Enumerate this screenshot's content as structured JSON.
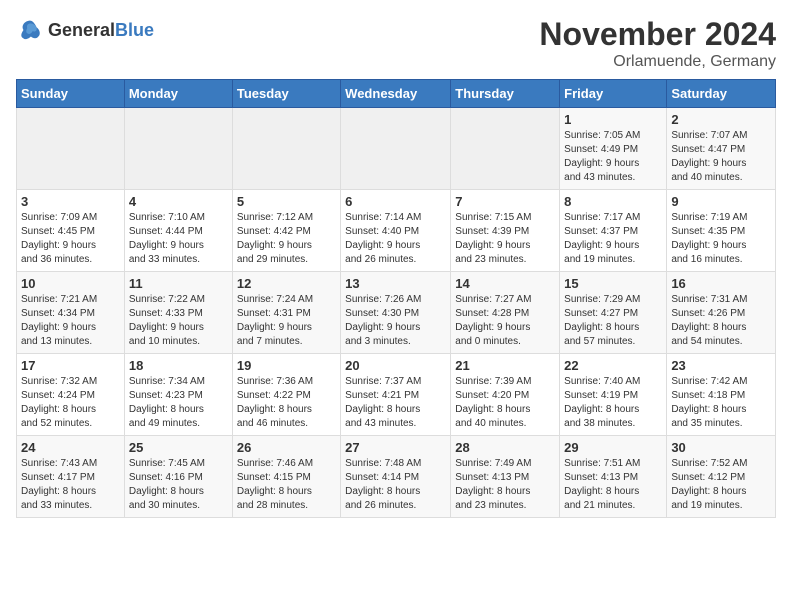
{
  "header": {
    "logo_general": "General",
    "logo_blue": "Blue",
    "month": "November 2024",
    "location": "Orlamuende, Germany"
  },
  "weekdays": [
    "Sunday",
    "Monday",
    "Tuesday",
    "Wednesday",
    "Thursday",
    "Friday",
    "Saturday"
  ],
  "weeks": [
    [
      {
        "day": "",
        "info": ""
      },
      {
        "day": "",
        "info": ""
      },
      {
        "day": "",
        "info": ""
      },
      {
        "day": "",
        "info": ""
      },
      {
        "day": "",
        "info": ""
      },
      {
        "day": "1",
        "info": "Sunrise: 7:05 AM\nSunset: 4:49 PM\nDaylight: 9 hours\nand 43 minutes."
      },
      {
        "day": "2",
        "info": "Sunrise: 7:07 AM\nSunset: 4:47 PM\nDaylight: 9 hours\nand 40 minutes."
      }
    ],
    [
      {
        "day": "3",
        "info": "Sunrise: 7:09 AM\nSunset: 4:45 PM\nDaylight: 9 hours\nand 36 minutes."
      },
      {
        "day": "4",
        "info": "Sunrise: 7:10 AM\nSunset: 4:44 PM\nDaylight: 9 hours\nand 33 minutes."
      },
      {
        "day": "5",
        "info": "Sunrise: 7:12 AM\nSunset: 4:42 PM\nDaylight: 9 hours\nand 29 minutes."
      },
      {
        "day": "6",
        "info": "Sunrise: 7:14 AM\nSunset: 4:40 PM\nDaylight: 9 hours\nand 26 minutes."
      },
      {
        "day": "7",
        "info": "Sunrise: 7:15 AM\nSunset: 4:39 PM\nDaylight: 9 hours\nand 23 minutes."
      },
      {
        "day": "8",
        "info": "Sunrise: 7:17 AM\nSunset: 4:37 PM\nDaylight: 9 hours\nand 19 minutes."
      },
      {
        "day": "9",
        "info": "Sunrise: 7:19 AM\nSunset: 4:35 PM\nDaylight: 9 hours\nand 16 minutes."
      }
    ],
    [
      {
        "day": "10",
        "info": "Sunrise: 7:21 AM\nSunset: 4:34 PM\nDaylight: 9 hours\nand 13 minutes."
      },
      {
        "day": "11",
        "info": "Sunrise: 7:22 AM\nSunset: 4:33 PM\nDaylight: 9 hours\nand 10 minutes."
      },
      {
        "day": "12",
        "info": "Sunrise: 7:24 AM\nSunset: 4:31 PM\nDaylight: 9 hours\nand 7 minutes."
      },
      {
        "day": "13",
        "info": "Sunrise: 7:26 AM\nSunset: 4:30 PM\nDaylight: 9 hours\nand 3 minutes."
      },
      {
        "day": "14",
        "info": "Sunrise: 7:27 AM\nSunset: 4:28 PM\nDaylight: 9 hours\nand 0 minutes."
      },
      {
        "day": "15",
        "info": "Sunrise: 7:29 AM\nSunset: 4:27 PM\nDaylight: 8 hours\nand 57 minutes."
      },
      {
        "day": "16",
        "info": "Sunrise: 7:31 AM\nSunset: 4:26 PM\nDaylight: 8 hours\nand 54 minutes."
      }
    ],
    [
      {
        "day": "17",
        "info": "Sunrise: 7:32 AM\nSunset: 4:24 PM\nDaylight: 8 hours\nand 52 minutes."
      },
      {
        "day": "18",
        "info": "Sunrise: 7:34 AM\nSunset: 4:23 PM\nDaylight: 8 hours\nand 49 minutes."
      },
      {
        "day": "19",
        "info": "Sunrise: 7:36 AM\nSunset: 4:22 PM\nDaylight: 8 hours\nand 46 minutes."
      },
      {
        "day": "20",
        "info": "Sunrise: 7:37 AM\nSunset: 4:21 PM\nDaylight: 8 hours\nand 43 minutes."
      },
      {
        "day": "21",
        "info": "Sunrise: 7:39 AM\nSunset: 4:20 PM\nDaylight: 8 hours\nand 40 minutes."
      },
      {
        "day": "22",
        "info": "Sunrise: 7:40 AM\nSunset: 4:19 PM\nDaylight: 8 hours\nand 38 minutes."
      },
      {
        "day": "23",
        "info": "Sunrise: 7:42 AM\nSunset: 4:18 PM\nDaylight: 8 hours\nand 35 minutes."
      }
    ],
    [
      {
        "day": "24",
        "info": "Sunrise: 7:43 AM\nSunset: 4:17 PM\nDaylight: 8 hours\nand 33 minutes."
      },
      {
        "day": "25",
        "info": "Sunrise: 7:45 AM\nSunset: 4:16 PM\nDaylight: 8 hours\nand 30 minutes."
      },
      {
        "day": "26",
        "info": "Sunrise: 7:46 AM\nSunset: 4:15 PM\nDaylight: 8 hours\nand 28 minutes."
      },
      {
        "day": "27",
        "info": "Sunrise: 7:48 AM\nSunset: 4:14 PM\nDaylight: 8 hours\nand 26 minutes."
      },
      {
        "day": "28",
        "info": "Sunrise: 7:49 AM\nSunset: 4:13 PM\nDaylight: 8 hours\nand 23 minutes."
      },
      {
        "day": "29",
        "info": "Sunrise: 7:51 AM\nSunset: 4:13 PM\nDaylight: 8 hours\nand 21 minutes."
      },
      {
        "day": "30",
        "info": "Sunrise: 7:52 AM\nSunset: 4:12 PM\nDaylight: 8 hours\nand 19 minutes."
      }
    ]
  ]
}
